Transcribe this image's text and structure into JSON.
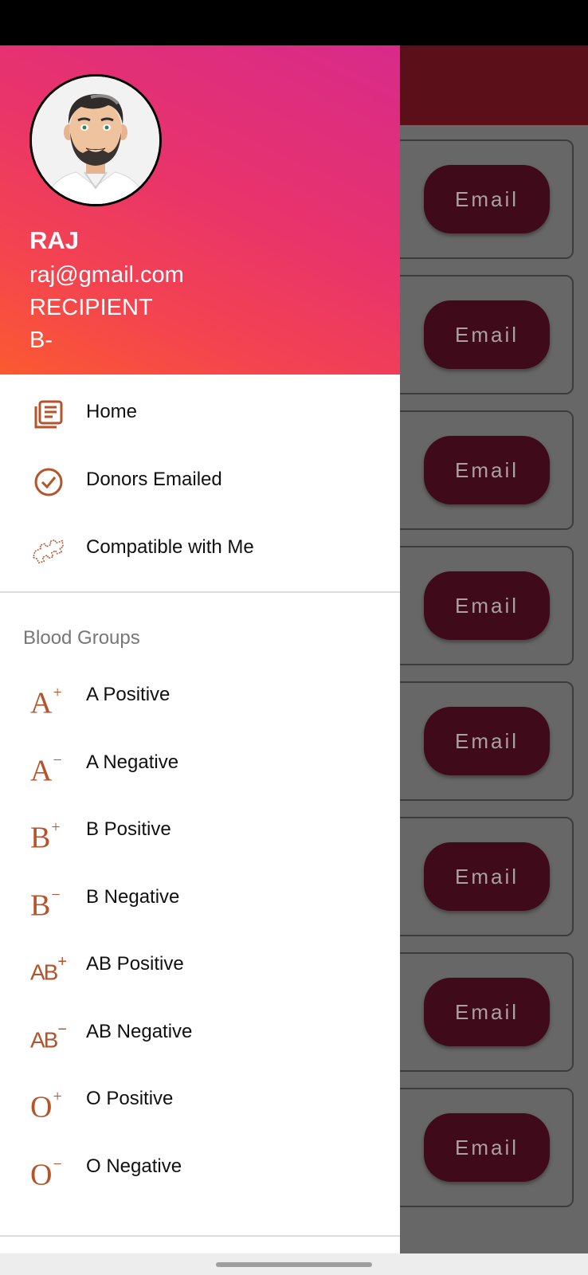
{
  "profile": {
    "name": "RAJ",
    "email": "raj@gmail.com",
    "role": "RECIPIENT",
    "blood_group": "B-"
  },
  "menu": [
    {
      "label": "Home",
      "icon": "list-book-icon"
    },
    {
      "label": "Donors Emailed",
      "icon": "check-circle-icon"
    },
    {
      "label": "Compatible with Me",
      "icon": "puzzle-icon"
    }
  ],
  "blood_groups": {
    "title": "Blood Groups",
    "items": [
      {
        "label": "A Positive",
        "symbol": "A",
        "sign": "+"
      },
      {
        "label": "A Negative",
        "symbol": "A",
        "sign": "−"
      },
      {
        "label": "B Positive",
        "symbol": "B",
        "sign": "+"
      },
      {
        "label": "B Negative",
        "symbol": "B",
        "sign": "−"
      },
      {
        "label": "AB Positive",
        "symbol": "AB",
        "sign": "+"
      },
      {
        "label": "AB Negative",
        "symbol": "AB",
        "sign": "−"
      },
      {
        "label": "O Positive",
        "symbol": "O",
        "sign": "+"
      },
      {
        "label": "O Negative",
        "symbol": "O",
        "sign": "−"
      }
    ]
  },
  "background": {
    "email_buttons": [
      "Email",
      "Email",
      "Email",
      "Email",
      "Email",
      "Email",
      "Email",
      "Email"
    ]
  },
  "colors": {
    "accent": "#b5532b",
    "header_gradient_start": "#d82a8a",
    "header_gradient_end": "#fb5a30",
    "toolbar": "#5b1019",
    "email_button": "#3f0a1a"
  }
}
